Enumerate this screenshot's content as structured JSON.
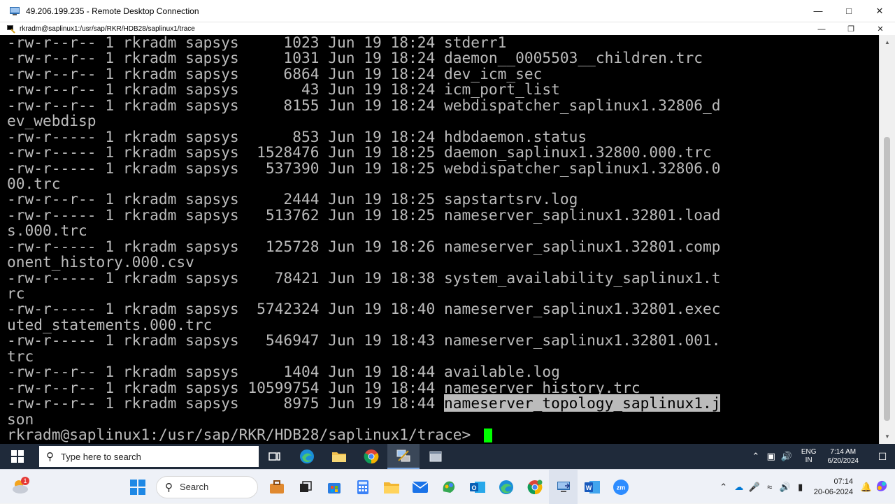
{
  "rdc": {
    "title": "49.206.199.235 - Remote Desktop Connection"
  },
  "putty": {
    "title": "rkradm@saplinux1:/usr/sap/RKR/HDB28/saplinux1/trace"
  },
  "terminal": {
    "lines": [
      "-rw-r--r-- 1 rkradm sapsys     1023 Jun 19 18:24 stderr1",
      "-rw-r--r-- 1 rkradm sapsys     1031 Jun 19 18:24 daemon__0005503__children.trc",
      "-rw-r--r-- 1 rkradm sapsys     6864 Jun 19 18:24 dev_icm_sec",
      "-rw-r--r-- 1 rkradm sapsys       43 Jun 19 18:24 icm_port_list",
      "-rw-r--r-- 1 rkradm sapsys     8155 Jun 19 18:24 webdispatcher_saplinux1.32806_d",
      "ev_webdisp",
      "-rw-r----- 1 rkradm sapsys      853 Jun 19 18:24 hdbdaemon.status",
      "-rw-r----- 1 rkradm sapsys  1528476 Jun 19 18:25 daemon_saplinux1.32800.000.trc",
      "-rw-r----- 1 rkradm sapsys   537390 Jun 19 18:25 webdispatcher_saplinux1.32806.0",
      "00.trc",
      "-rw-r--r-- 1 rkradm sapsys     2444 Jun 19 18:25 sapstartsrv.log",
      "-rw-r----- 1 rkradm sapsys   513762 Jun 19 18:25 nameserver_saplinux1.32801.load",
      "s.000.trc",
      "-rw-r----- 1 rkradm sapsys   125728 Jun 19 18:26 nameserver_saplinux1.32801.comp",
      "onent_history.000.csv",
      "-rw-r----- 1 rkradm sapsys    78421 Jun 19 18:38 system_availability_saplinux1.t",
      "rc",
      "-rw-r----- 1 rkradm sapsys  5742324 Jun 19 18:40 nameserver_saplinux1.32801.exec",
      "uted_statements.000.trc",
      "-rw-r----- 1 rkradm sapsys   546947 Jun 19 18:43 nameserver_saplinux1.32801.001.",
      "trc",
      "-rw-r--r-- 1 rkradm sapsys     1404 Jun 19 18:44 available.log",
      "-rw-r--r-- 1 rkradm sapsys 10599754 Jun 19 18:44 nameserver_history.trc"
    ],
    "last_line_prefix": "-rw-r--r-- 1 rkradm sapsys     8975 Jun 19 18:44 ",
    "last_line_selected": "nameserver_topology_saplinux1.j",
    "wrap_line": "son",
    "prompt": "rkradm@saplinux1:/usr/sap/RKR/HDB28/saplinux1/trace> "
  },
  "remote_taskbar": {
    "search_placeholder": "Type here to search",
    "lang_top": "ENG",
    "lang_bottom": "IN",
    "time": "7:14 AM",
    "date": "6/20/2024"
  },
  "local_taskbar": {
    "search_label": "Search",
    "weather_badge": "1",
    "time": "07:14",
    "date": "20-06-2024"
  },
  "colors": {
    "terminal_bg": "#000000",
    "terminal_fg": "#bbbbbb",
    "cursor": "#00ff00",
    "remote_taskbar": "#1f2a3a"
  }
}
